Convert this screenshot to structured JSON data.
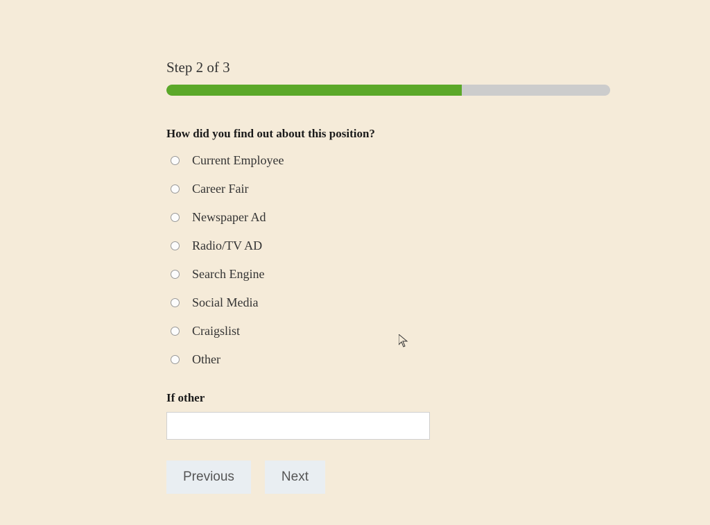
{
  "step": {
    "label": "Step 2 of 3",
    "progress_percent": 66.6
  },
  "question": "How did you find out about this position?",
  "options": [
    "Current Employee",
    "Career Fair",
    "Newspaper Ad",
    "Radio/TV AD",
    "Search Engine",
    "Social Media",
    "Craigslist",
    "Other"
  ],
  "if_other": {
    "label": "If other",
    "value": ""
  },
  "buttons": {
    "previous": "Previous",
    "next": "Next"
  }
}
